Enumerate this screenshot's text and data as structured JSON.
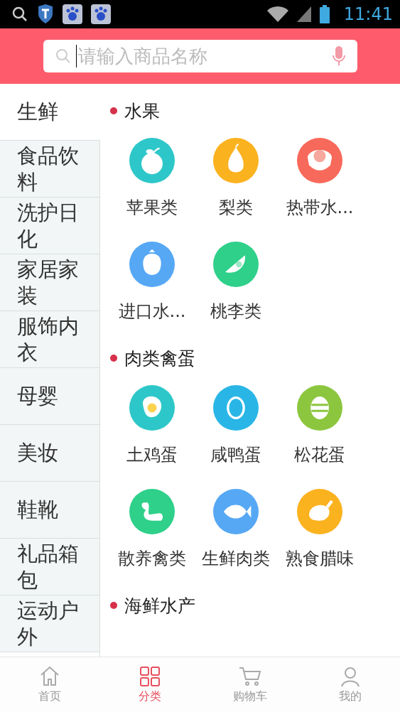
{
  "status_bar": {
    "time": "11:41"
  },
  "search": {
    "placeholder": "请输入商品名称"
  },
  "sidebar": {
    "items": [
      {
        "label": "生鲜",
        "selected": true
      },
      {
        "label": "食品饮料",
        "selected": false
      },
      {
        "label": "洗护日化",
        "selected": false
      },
      {
        "label": "家居家装",
        "selected": false
      },
      {
        "label": "服饰内衣",
        "selected": false
      },
      {
        "label": "母婴",
        "selected": false
      },
      {
        "label": "美妆",
        "selected": false
      },
      {
        "label": "鞋靴",
        "selected": false
      },
      {
        "label": "礼品箱包",
        "selected": false
      },
      {
        "label": "运动户外",
        "selected": false
      }
    ]
  },
  "sections": [
    {
      "title": "水果",
      "items": [
        {
          "label": "苹果类",
          "color": "#2ec7c9"
        },
        {
          "label": "梨类",
          "color": "#fbb21f"
        },
        {
          "label": "热带水...",
          "color": "#f7695a"
        },
        {
          "label": "进口水...",
          "color": "#56a8f5"
        },
        {
          "label": "桃李类",
          "color": "#2fd08a"
        }
      ]
    },
    {
      "title": "肉类禽蛋",
      "items": [
        {
          "label": "土鸡蛋",
          "color": "#2ec7c9"
        },
        {
          "label": "咸鸭蛋",
          "color": "#29b6e6"
        },
        {
          "label": "松花蛋",
          "color": "#8cc63f"
        },
        {
          "label": "散养禽类",
          "color": "#2fd08a"
        },
        {
          "label": "生鲜肉类",
          "color": "#56a8f5"
        },
        {
          "label": "熟食腊味",
          "color": "#fbb21f"
        }
      ]
    },
    {
      "title": "海鲜水产"
    }
  ],
  "bottom_nav": [
    {
      "label": "首页",
      "selected": false
    },
    {
      "label": "分类",
      "selected": true
    },
    {
      "label": "购物车",
      "selected": false
    },
    {
      "label": "我的",
      "selected": false
    }
  ]
}
